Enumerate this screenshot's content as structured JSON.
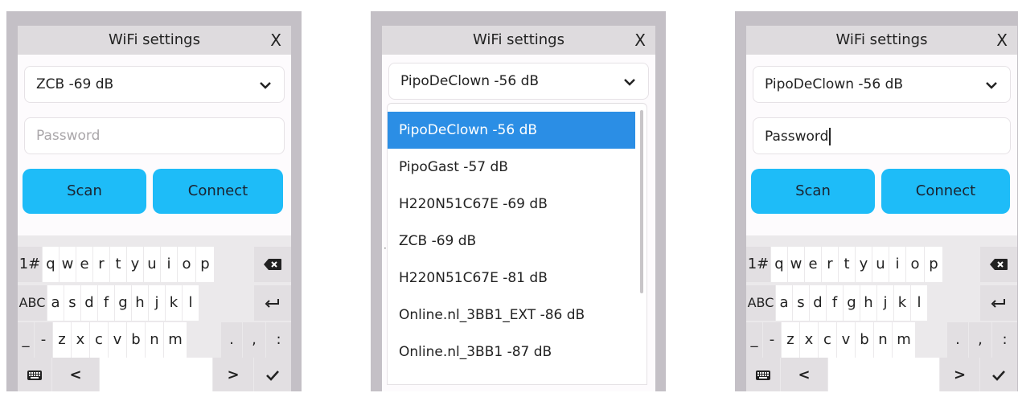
{
  "screens": [
    {
      "title": "WiFi settings",
      "close": "X",
      "dropdown_value": "ZCB -69 dB",
      "password_placeholder": "Password",
      "password_value": "",
      "scan_label": "Scan",
      "connect_label": "Connect",
      "keyboard": {
        "row1": [
          "1#",
          "q",
          "w",
          "e",
          "r",
          "t",
          "y",
          "u",
          "i",
          "o",
          "p"
        ],
        "row2": [
          "ABC",
          "a",
          "s",
          "d",
          "f",
          "g",
          "h",
          "j",
          "k",
          "l"
        ],
        "row3": [
          "_",
          "-",
          "z",
          "x",
          "c",
          "v",
          "b",
          "n",
          "m",
          ".",
          ",",
          ":"
        ],
        "row4_left": "<",
        "row4_right": ">",
        "icons": [
          "backspace-icon",
          "enter-icon",
          "keyboard-icon",
          "check-icon"
        ]
      }
    },
    {
      "title": "WiFi settings",
      "close": "X",
      "dropdown_value": "PipoDeClown -56 dB",
      "options": [
        "PipoDeClown -56 dB",
        "PipoGast -57 dB",
        "H220N51C67E -69 dB",
        "ZCB -69 dB",
        "H220N51C67E -81 dB",
        "Online.nl_3BB1_EXT -86 dB",
        "Online.nl_3BB1 -87 dB"
      ],
      "selected_index": 0
    },
    {
      "title": "WiFi settings",
      "close": "X",
      "dropdown_value": "PipoDeClown -56 dB",
      "password_value": "Password",
      "scan_label": "Scan",
      "connect_label": "Connect",
      "keyboard": {
        "row1": [
          "1#",
          "q",
          "w",
          "e",
          "r",
          "t",
          "y",
          "u",
          "i",
          "o",
          "p"
        ],
        "row2": [
          "ABC",
          "a",
          "s",
          "d",
          "f",
          "g",
          "h",
          "j",
          "k",
          "l"
        ],
        "row3": [
          "_",
          "-",
          "z",
          "x",
          "c",
          "v",
          "b",
          "n",
          "m",
          ".",
          ",",
          ":"
        ],
        "row4_left": "<",
        "row4_right": ">"
      }
    }
  ],
  "colors": {
    "button": "#1ebcf8",
    "selected_option": "#2b8ee5",
    "frame": "#c4c0c6"
  }
}
